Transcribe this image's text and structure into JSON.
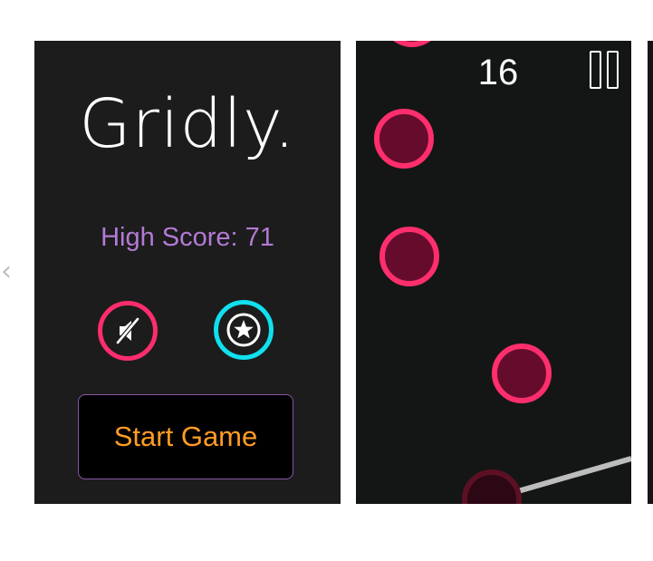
{
  "navigation": {
    "prev_glyph": "‹"
  },
  "menu_screen": {
    "title": "Gridly.",
    "high_score": "High Score: 71",
    "mute_icon": "speaker-muted-icon",
    "star_icon": "star-icon",
    "start_label": "Start Game"
  },
  "game_screen": {
    "score": "16",
    "pause_icon": "pause-icon"
  },
  "colors": {
    "menu_background": "#1c1c1c",
    "game_background": "#141616",
    "title": "#ffffff",
    "high_score": "#b37ad6",
    "mute_ring": "#ff2d6d",
    "star_ring": "#10e0ef",
    "start_text": "#ff9c24",
    "start_border": "#8a54a8",
    "dot_ring": "#ff2e6d",
    "dot_fill": "#650c2d",
    "line": "#bdbdbd"
  }
}
